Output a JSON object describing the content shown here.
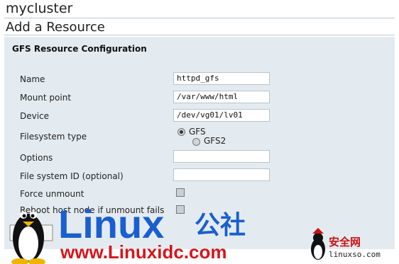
{
  "header": {
    "cluster_name": "mycluster",
    "page_title": "Add a Resource"
  },
  "form": {
    "section_title": "GFS Resource Configuration",
    "name": {
      "label": "Name",
      "value": "httpd_gfs"
    },
    "mount_point": {
      "label": "Mount point",
      "value": "/var/www/html"
    },
    "device": {
      "label": "Device",
      "value": "/dev/vg01/lv01"
    },
    "filesystem_type": {
      "label": "Filesystem type",
      "options": [
        "GFS",
        "GFS2"
      ],
      "selected": "GFS"
    },
    "options": {
      "label": "Options",
      "value": ""
    },
    "fsid": {
      "label": "File system ID (optional)",
      "value": ""
    },
    "force_unmount": {
      "label": "Force unmount",
      "checked": false
    },
    "reboot_on_fail": {
      "label": "Reboot host node if unmount fails",
      "checked": false
    }
  },
  "watermark": {
    "brand": "Linux",
    "brand_cn": "公社",
    "url": "www.Linuxidc.com",
    "site_cn": "安全网",
    "site_url": "linuxso.com"
  },
  "colors": {
    "brand_blue": "#1a5fd0",
    "url_red": "#d8141a",
    "panel_bg": "#e4ebf0"
  }
}
